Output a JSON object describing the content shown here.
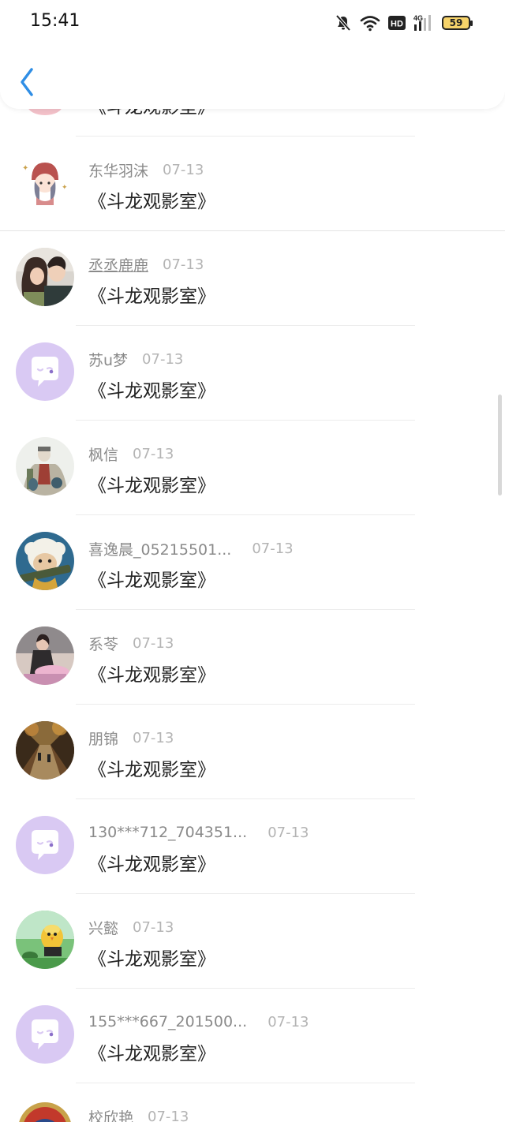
{
  "status_bar": {
    "time": "15:41",
    "network": "4G",
    "hd": "HD",
    "battery": "59"
  },
  "header": {
    "back_icon": "chevron-left-icon",
    "accent_color": "#2f8ee5"
  },
  "comments": [
    {
      "username": "",
      "date": "",
      "text": "《斗龙观影室》",
      "avatar": "pink-partial"
    },
    {
      "username": "东华羽沫",
      "date": "07-13",
      "text": "《斗龙观影室》",
      "avatar": "cartoon-girl"
    },
    {
      "username": "丞丞鹿鹿",
      "date": "07-13",
      "text": "《斗龙观影室》",
      "avatar": "couple-photo"
    },
    {
      "username": "苏u梦",
      "date": "07-13",
      "text": "《斗龙观影室》",
      "avatar": "default-chat"
    },
    {
      "username": "枫信",
      "date": "07-13",
      "text": "《斗龙观影室》",
      "avatar": "anime-soldier"
    },
    {
      "username": "喜逸晨_05215501...",
      "date": "07-13",
      "text": "《斗龙观影室》",
      "avatar": "cartoon-sheep"
    },
    {
      "username": "系苓",
      "date": "07-13",
      "text": "《斗龙观影室》",
      "avatar": "girl-photo"
    },
    {
      "username": "朋锦",
      "date": "07-13",
      "text": "《斗龙观影室》",
      "avatar": "autumn-road"
    },
    {
      "username": "130***712_704351...",
      "date": "07-13",
      "text": "《斗龙观影室》",
      "avatar": "default-chat"
    },
    {
      "username": "兴懿",
      "date": "07-13",
      "text": "《斗龙观影室》",
      "avatar": "toy-chick"
    },
    {
      "username": "155***667_201500...",
      "date": "07-13",
      "text": "《斗龙观影室》",
      "avatar": "default-chat"
    },
    {
      "username": "校欣艳",
      "date": "07-13",
      "text": "",
      "avatar": "badge-partial"
    }
  ]
}
